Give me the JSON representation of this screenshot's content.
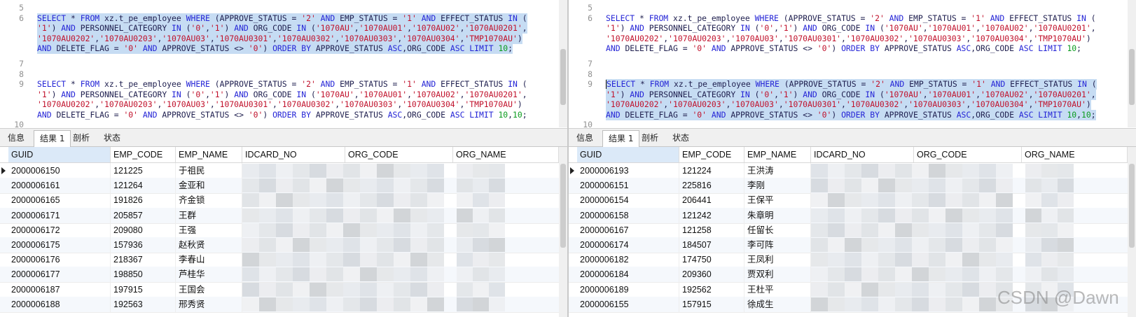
{
  "tabs": [
    "信息",
    "结果 1",
    "剖析",
    "状态"
  ],
  "columns": [
    "GUID",
    "EMP_CODE",
    "EMP_NAME",
    "IDCARD_NO",
    "ORG_CODE",
    "ORG_NAME"
  ],
  "panes": [
    {
      "editor": {
        "line_numbers": [
          "5",
          "6",
          "",
          "",
          "",
          "7",
          "8",
          "9",
          "",
          "",
          "",
          "10"
        ],
        "query1": {
          "l1": "SELECT * FROM xz.t_pe_employee WHERE (APPROVE_STATUS = '2' AND EMP_STATUS = '1' AND EFFECT_STATUS IN (",
          "l2": "'1') AND PERSONNEL_CATEGORY IN ('0','1') AND ORG_CODE IN ('1070AU','1070AU01','1070AU02','1070AU0201',",
          "l3": "'1070AU0202','1070AU0203','1070AU03','1070AU0301','1070AU0302','1070AU0303','1070AU0304','TMP1070AU')",
          "l4": "AND DELETE_FLAG = '0' AND APPROVE_STATUS <> '0') ORDER BY APPROVE_STATUS ASC,ORG_CODE ASC LIMIT 10;"
        },
        "query2": {
          "l1": "SELECT * FROM xz.t_pe_employee WHERE (APPROVE_STATUS = '2' AND EMP_STATUS = '1' AND EFFECT_STATUS IN (",
          "l2": "'1') AND PERSONNEL_CATEGORY IN ('0','1') AND ORG_CODE IN ('1070AU','1070AU01','1070AU02','1070AU0201',",
          "l3": "'1070AU0202','1070AU0203','1070AU03','1070AU0301','1070AU0302','1070AU0303','1070AU0304','TMP1070AU')",
          "l4": "AND DELETE_FLAG = '0' AND APPROVE_STATUS <> '0') ORDER BY APPROVE_STATUS ASC,ORG_CODE ASC LIMIT 10,10;"
        }
      },
      "rows": [
        {
          "guid": "2000006150",
          "emp_code": "121225",
          "emp_name": "于祖民"
        },
        {
          "guid": "2000006161",
          "emp_code": "121264",
          "emp_name": "金亚和"
        },
        {
          "guid": "2000006165",
          "emp_code": "191826",
          "emp_name": "齐金锁"
        },
        {
          "guid": "2000006171",
          "emp_code": "205857",
          "emp_name": "王群"
        },
        {
          "guid": "2000006172",
          "emp_code": "209080",
          "emp_name": "王强"
        },
        {
          "guid": "2000006175",
          "emp_code": "157936",
          "emp_name": "赵秋贤"
        },
        {
          "guid": "2000006176",
          "emp_code": "218367",
          "emp_name": "李春山"
        },
        {
          "guid": "2000006177",
          "emp_code": "198850",
          "emp_name": "芦桂华"
        },
        {
          "guid": "2000006187",
          "emp_code": "197915",
          "emp_name": "王国会"
        },
        {
          "guid": "2000006188",
          "emp_code": "192563",
          "emp_name": "邢秀贤"
        }
      ]
    },
    {
      "editor": {
        "line_numbers": [
          "5",
          "6",
          "",
          "",
          "",
          "7",
          "8",
          "9",
          "",
          "",
          "",
          "10"
        ],
        "query1": {
          "l1": "SELECT * FROM xz.t_pe_employee WHERE (APPROVE_STATUS = '2' AND EMP_STATUS = '1' AND EFFECT_STATUS IN (",
          "l2": "'1') AND PERSONNEL_CATEGORY IN ('0','1') AND ORG_CODE IN ('1070AU','1070AU01','1070AU02','1070AU0201',",
          "l3": "'1070AU0202','1070AU0203','1070AU03','1070AU0301','1070AU0302','1070AU0303','1070AU0304','TMP1070AU')",
          "l4": "AND DELETE_FLAG = '0' AND APPROVE_STATUS <> '0') ORDER BY APPROVE_STATUS ASC,ORG_CODE ASC LIMIT 10;"
        },
        "query2": {
          "l1": "SELECT * FROM xz.t_pe_employee WHERE (APPROVE_STATUS = '2' AND EMP_STATUS = '1' AND EFFECT_STATUS IN (",
          "l2": "'1') AND PERSONNEL_CATEGORY IN ('0','1') AND ORG_CODE IN ('1070AU','1070AU01','1070AU02','1070AU0201',",
          "l3": "'1070AU0202','1070AU0203','1070AU03','1070AU0301','1070AU0302','1070AU0303','1070AU0304','TMP1070AU')",
          "l4": "AND DELETE_FLAG = '0' AND APPROVE_STATUS <> '0') ORDER BY APPROVE_STATUS ASC,ORG_CODE ASC LIMIT 10,10;"
        }
      },
      "rows": [
        {
          "guid": "2000006193",
          "emp_code": "121224",
          "emp_name": "王洪涛"
        },
        {
          "guid": "2000006151",
          "emp_code": "225816",
          "emp_name": "李刚"
        },
        {
          "guid": "2000006154",
          "emp_code": "206441",
          "emp_name": "王保平"
        },
        {
          "guid": "2000006158",
          "emp_code": "121242",
          "emp_name": "朱章明"
        },
        {
          "guid": "2000006167",
          "emp_code": "121258",
          "emp_name": "任留长"
        },
        {
          "guid": "2000006174",
          "emp_code": "184507",
          "emp_name": "李可阵"
        },
        {
          "guid": "2000006182",
          "emp_code": "174750",
          "emp_name": "王凤利"
        },
        {
          "guid": "2000006184",
          "emp_code": "209360",
          "emp_name": "贾双利"
        },
        {
          "guid": "2000006189",
          "emp_code": "192562",
          "emp_name": "王杜平"
        },
        {
          "guid": "2000006155",
          "emp_code": "157915",
          "emp_name": "徐成生"
        }
      ]
    }
  ],
  "watermark": "CSDN @Dawn",
  "colors": {
    "keyword": "#2424d6",
    "string": "#c0102a",
    "number": "#0a9b1e",
    "selection": "#c6dcf3"
  }
}
